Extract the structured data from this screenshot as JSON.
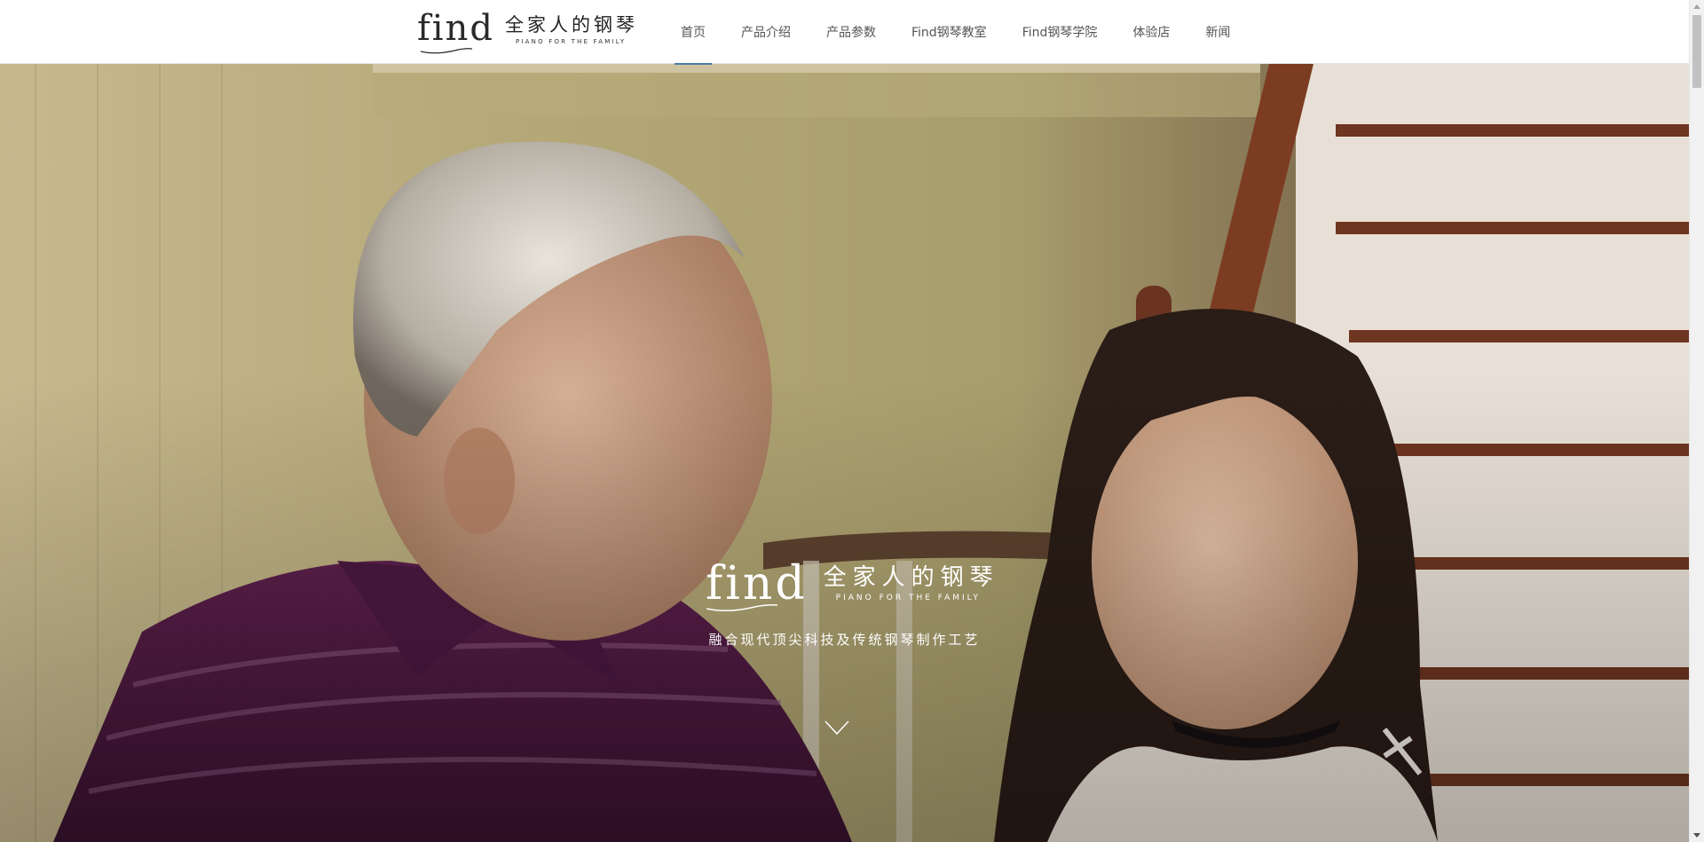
{
  "header": {
    "logo": {
      "wordmark": "find",
      "chinese": "全家人的钢琴",
      "english": "PIANO FOR THE FAMILY"
    },
    "nav": [
      {
        "label": "首页",
        "active": true
      },
      {
        "label": "产品介绍",
        "active": false
      },
      {
        "label": "产品参数",
        "active": false
      },
      {
        "label": "Find钢琴教室",
        "active": false
      },
      {
        "label": "Find钢琴学院",
        "active": false
      },
      {
        "label": "体验店",
        "active": false
      },
      {
        "label": "新闻",
        "active": false
      }
    ],
    "accent_color": "#4a7aa8"
  },
  "hero": {
    "logo": {
      "wordmark": "find",
      "chinese": "全家人的钢琴",
      "english": "PIANO FOR THE FAMILY"
    },
    "tagline": "融合现代顶尖科技及传统钢琴制作工艺",
    "scroll_icon": "chevron-down-icon",
    "image_subject": "grandfather-and-granddaughter-photo"
  }
}
